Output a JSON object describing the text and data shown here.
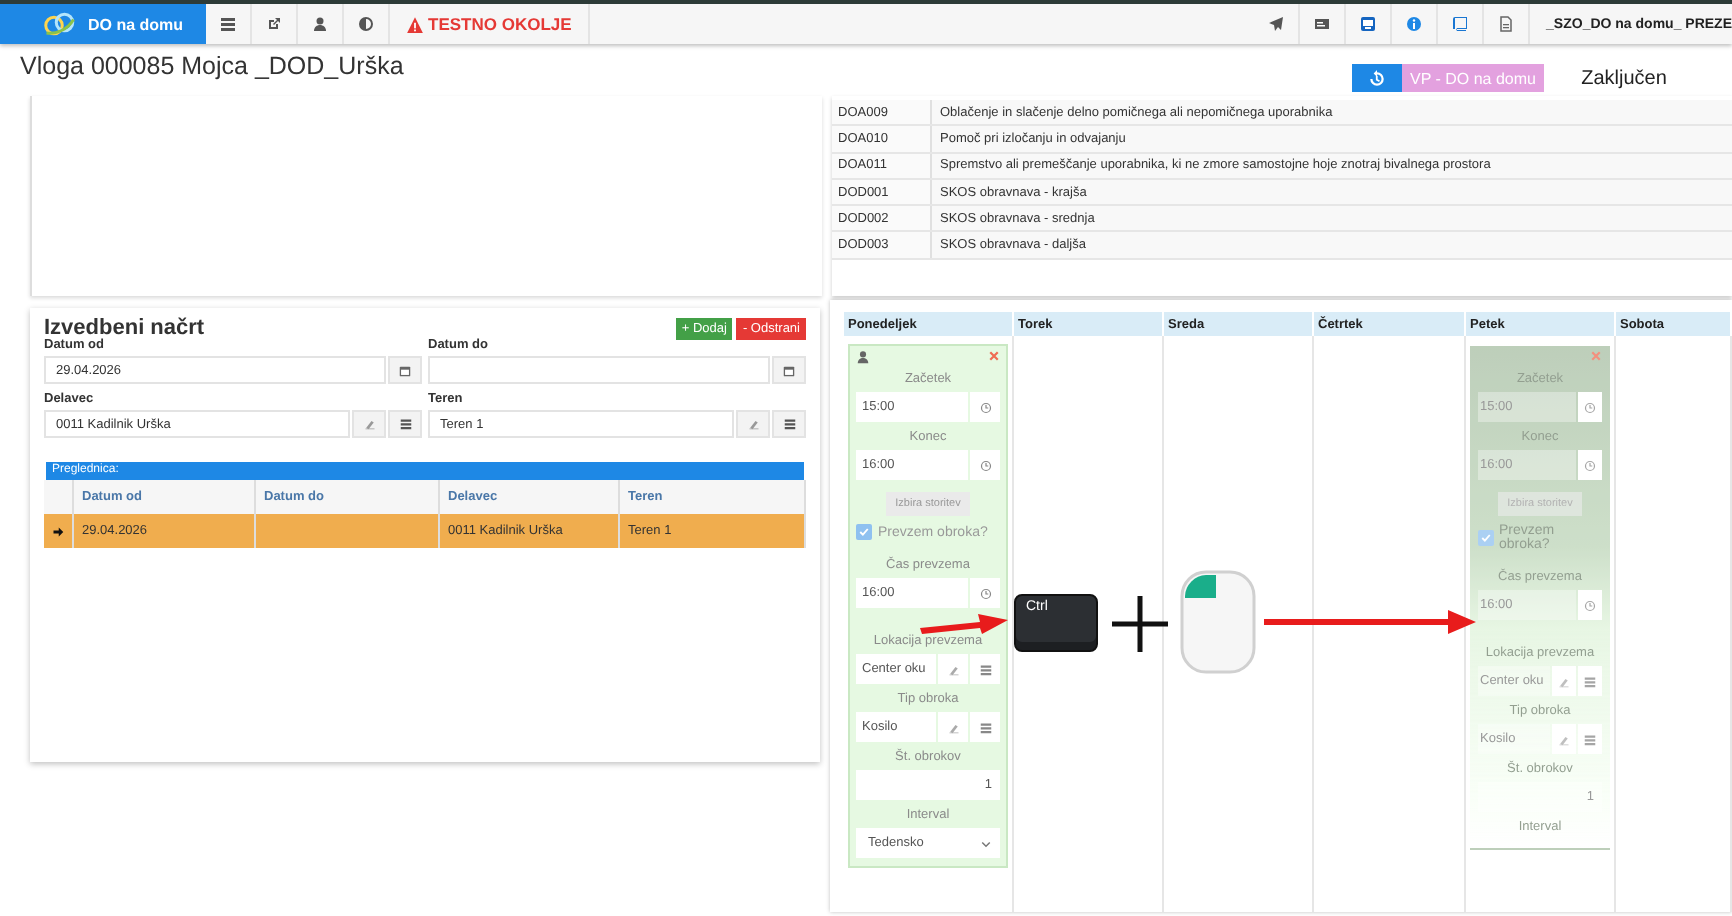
{
  "topbar": {
    "brand": "DO na domu",
    "warning": "TESTNO OKOLJE",
    "user": "_SZO_DO na domu_ PREZE"
  },
  "header": {
    "title": "Vloga 000085 Mojca _DOD_Urška",
    "program": "VP - DO na domu",
    "status": "Zaključen"
  },
  "services": {
    "rows": [
      {
        "code": "DOA009",
        "name": "Oblačenje in slačenje delno pomičnega ali nepomičnega uporabnika"
      },
      {
        "code": "DOA010",
        "name": "Pomoč pri izločanju in odvajanju"
      },
      {
        "code": "DOA011",
        "name": "Spremstvo ali premeščanje uporabnika, ki ne zmore samostojne hoje znotraj bivalnega prostora"
      },
      {
        "code": "DOD001",
        "name": "SKOS obravnava - krajša"
      },
      {
        "code": "DOD002",
        "name": "SKOS obravnava - srednja"
      },
      {
        "code": "DOD003",
        "name": "SKOS obravnava - daljša"
      }
    ]
  },
  "plan": {
    "title": "Izvedbeni načrt",
    "add": "+ Dodaj",
    "remove": "- Odstrani",
    "fields": [
      {
        "kind": "date",
        "label": "Datum od",
        "value": "29.04.2026"
      },
      {
        "kind": "date",
        "label": "Datum do"
      },
      {
        "kind": "lookup",
        "label": "Delavec",
        "value": "0011 Kadilnik Urška"
      },
      {
        "kind": "lookup",
        "label": "Teren",
        "value": "Teren 1"
      }
    ],
    "grid": {
      "caption": "Preglednica:",
      "columns": [
        "Datum od",
        "Datum do",
        "Delavec",
        "Teren"
      ],
      "rows": [
        {
          "selected": true,
          "cells": [
            "29.04.2026",
            null,
            "0011 Kadilnik Urška",
            "Teren 1"
          ]
        }
      ]
    }
  },
  "calendar": {
    "days": [
      {
        "name": "Ponedeljek",
        "cards": [
          {
            "kind": "card",
            "fields": [
              {
                "kind": "time",
                "label": "Začetek",
                "value": "15:00"
              },
              {
                "kind": "time",
                "label": "Konec",
                "value": "16:00"
              },
              {
                "kind": "button",
                "label": "Izbira storitev"
              },
              {
                "kind": "checkbox",
                "label": "Prevzem obroka?",
                "checked": true
              },
              {
                "kind": "time",
                "label": "Čas prevzema",
                "value": "16:00"
              },
              {
                "kind": "lookup",
                "label": "Lokacija prevzema",
                "value": "Center oku"
              },
              {
                "kind": "lookup",
                "label": "Tip obroka",
                "value": "Kosilo"
              },
              {
                "kind": "number",
                "label": "Št. obrokov",
                "value": "1"
              },
              {
                "kind": "select",
                "label": "Interval",
                "value": "Tedensko"
              }
            ]
          }
        ]
      },
      {
        "name": "Torek"
      },
      {
        "name": "Sreda"
      },
      {
        "name": "Četrtek"
      },
      {
        "name": "Petek",
        "cards": [
          {
            "kind": "drag_preview",
            "fields": [
              {
                "kind": "time",
                "label": "Začetek",
                "value": "15:00"
              },
              {
                "kind": "time",
                "label": "Konec",
                "value": "16:00"
              },
              {
                "kind": "button",
                "label": "Izbira storitev"
              },
              {
                "kind": "checkbox",
                "label": "Prevzem obroka?",
                "checked": true
              },
              {
                "kind": "time",
                "label": "Čas prevzema",
                "value": "16:00"
              },
              {
                "kind": "lookup",
                "label": "Lokacija prevzema",
                "value": "Center oku"
              },
              {
                "kind": "lookup",
                "label": "Tip obroka",
                "value": "Kosilo"
              },
              {
                "kind": "number",
                "label": "Št. obrokov",
                "value": "1"
              },
              {
                "kind": "label",
                "label": "Interval"
              }
            ]
          }
        ]
      },
      {
        "name": "Sobota"
      }
    ],
    "hint": {
      "key": "Ctrl"
    }
  }
}
